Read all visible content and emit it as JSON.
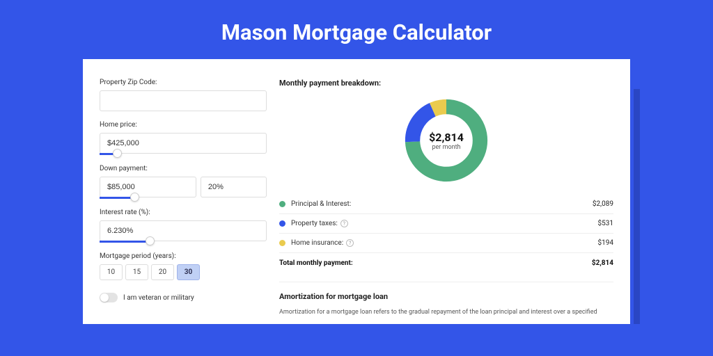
{
  "title": "Mason Mortgage Calculator",
  "form": {
    "zip_label": "Property Zip Code:",
    "zip_value": "",
    "price_label": "Home price:",
    "price_value": "$425,000",
    "down_label": "Down payment:",
    "down_value": "$85,000",
    "down_pct": "20%",
    "rate_label": "Interest rate (%):",
    "rate_value": "6.230%",
    "period_label": "Mortgage period (years):",
    "periods": [
      "10",
      "15",
      "20",
      "30"
    ],
    "period_active": "30",
    "veteran_label": "I am veteran or military"
  },
  "breakdown": {
    "heading": "Monthly payment breakdown:",
    "center_amount": "$2,814",
    "center_sub": "per month",
    "rows": [
      {
        "color": "green",
        "label": "Principal & Interest:",
        "value": "$2,089",
        "help": false
      },
      {
        "color": "blue",
        "label": "Property taxes:",
        "value": "$531",
        "help": true
      },
      {
        "color": "yellow",
        "label": "Home insurance:",
        "value": "$194",
        "help": true
      }
    ],
    "total_label": "Total monthly payment:",
    "total_value": "$2,814"
  },
  "amort": {
    "heading": "Amortization for mortgage loan",
    "text": "Amortization for a mortgage loan refers to the gradual repayment of the loan principal and interest over a specified"
  },
  "chart_data": {
    "type": "pie",
    "title": "Monthly payment breakdown",
    "series": [
      {
        "name": "Principal & Interest",
        "value": 2089,
        "color": "#4fae7f"
      },
      {
        "name": "Property taxes",
        "value": 531,
        "color": "#3355e8"
      },
      {
        "name": "Home insurance",
        "value": 194,
        "color": "#eacb4e"
      }
    ],
    "total": 2814,
    "center_label": "$2,814 per month"
  }
}
